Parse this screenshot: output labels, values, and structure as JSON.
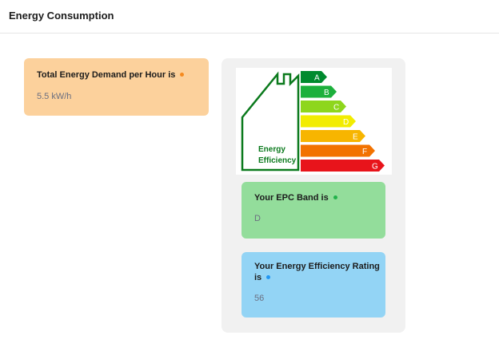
{
  "header": {
    "title": "Energy Consumption"
  },
  "demand_card": {
    "title": "Total Energy Demand per Hour is",
    "value": "5.5 kW/h",
    "dot_color": "#f58a1f",
    "bg_color": "#fcd19c"
  },
  "epc_image": {
    "label_line1": "Energy",
    "label_line2": "Efficiency",
    "bands": [
      {
        "letter": "A",
        "color": "#008a2e"
      },
      {
        "letter": "B",
        "color": "#1cb03c"
      },
      {
        "letter": "C",
        "color": "#8ed61c"
      },
      {
        "letter": "D",
        "color": "#f2ec00"
      },
      {
        "letter": "E",
        "color": "#f7b500"
      },
      {
        "letter": "F",
        "color": "#f27200"
      },
      {
        "letter": "G",
        "color": "#e8141b"
      }
    ]
  },
  "epc_card": {
    "title": "Your EPC Band is",
    "value": "D",
    "dot_color": "#21b24b",
    "bg_color": "#93dd9b"
  },
  "rating_card": {
    "title_line1": "Your Energy Efficiency Rating",
    "title_line2": "is",
    "value": "56",
    "dot_color": "#2196f3",
    "bg_color": "#93d4f5"
  }
}
